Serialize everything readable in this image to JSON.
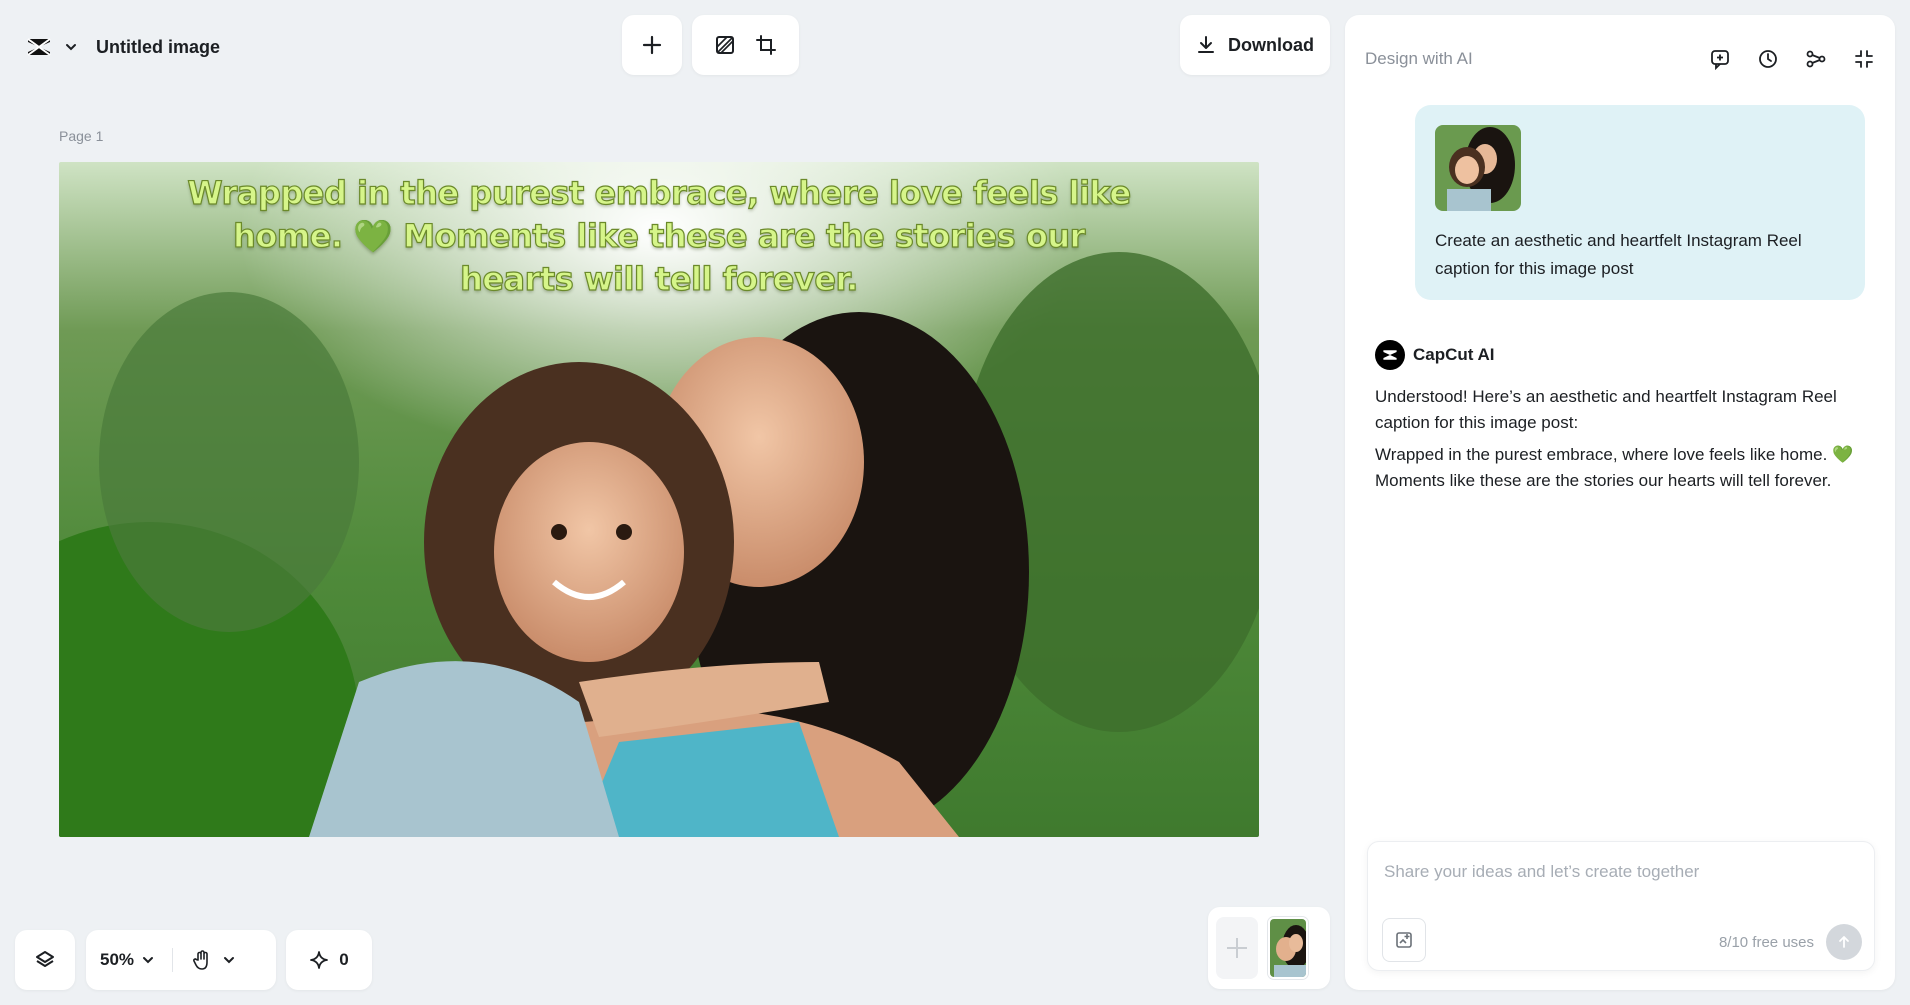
{
  "brand": {
    "title": "Untitled image",
    "logo_icon": "capcut-logo-icon"
  },
  "toolbar": {
    "add_icon": "plus-icon",
    "resize_icon": "background-remove-icon",
    "crop_icon": "crop-resize-icon",
    "download_label": "Download"
  },
  "canvas": {
    "page_label": "Page 1",
    "caption": "Wrapped in the purest embrace, where love feels like home. 💚 Moments like these are the stories our hearts will tell forever."
  },
  "bottom_tools": {
    "zoom": "50%",
    "ai_credits": "0"
  },
  "ai_panel": {
    "title": "Design with AI",
    "header_icons": [
      "new-chat-icon",
      "history-icon",
      "share-icon",
      "collapse-icon"
    ],
    "user_message": "Create an aesthetic and heartfelt Instagram Reel caption for this image post",
    "assistant_name": "CapCut AI",
    "reply_intro": "Understood! Here’s an aesthetic and heartfelt Instagram Reel caption for this image post:",
    "reply_caption": "Wrapped in the purest embrace, where love feels like home. 💚 Moments like these are the stories our hearts will tell forever.",
    "composer_placeholder": "Share your ideas and let’s create together",
    "free_uses": "8/10 free uses"
  },
  "colors": {
    "accent_caption": "#d6f58a",
    "bubble": "#dff2f6",
    "background": "#eef1f4"
  }
}
